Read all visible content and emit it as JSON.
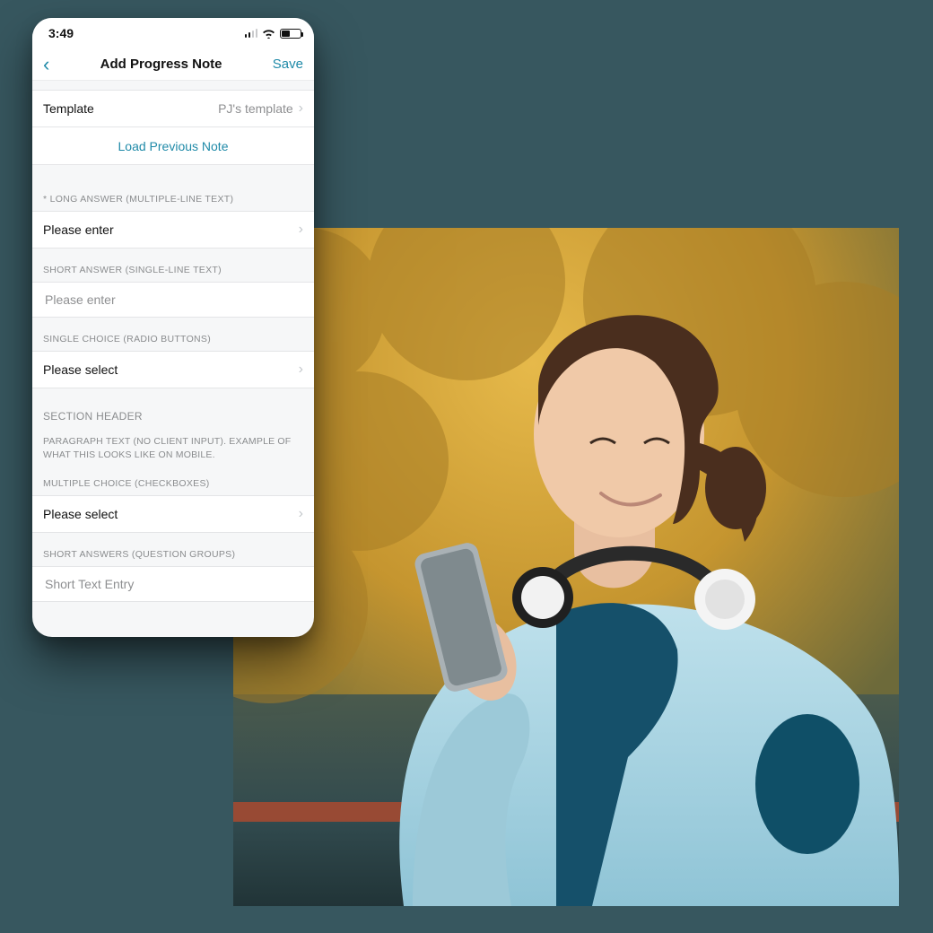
{
  "status": {
    "time": "3:49"
  },
  "nav": {
    "title": "Add Progress Note",
    "save": "Save"
  },
  "template_row": {
    "label": "Template",
    "value": "PJ's template"
  },
  "load_prev": "Load Previous Note",
  "sections": {
    "long_answer": {
      "label": "* LONG ANSWER (MULTIPLE-LINE TEXT)",
      "placeholder": "Please enter"
    },
    "short_answer": {
      "label": "SHORT ANSWER (SINGLE-LINE TEXT)",
      "placeholder": "Please enter"
    },
    "single_choice": {
      "label": "SINGLE CHOICE (RADIO BUTTONS)",
      "placeholder": "Please select"
    },
    "header": {
      "title": "SECTION HEADER",
      "paragraph": "PARAGRAPH TEXT (NO CLIENT INPUT). EXAMPLE OF WHAT THIS LOOKS LIKE ON MOBILE."
    },
    "multiple_choice": {
      "label": "MULTIPLE CHOICE (CHECKBOXES)",
      "placeholder": "Please select"
    },
    "question_groups": {
      "label": "SHORT ANSWERS (QUESTION GROUPS)",
      "placeholder": "Short Text Entry"
    }
  },
  "photo": {
    "alt": "Woman outdoors with headphones looking at a smartphone"
  }
}
